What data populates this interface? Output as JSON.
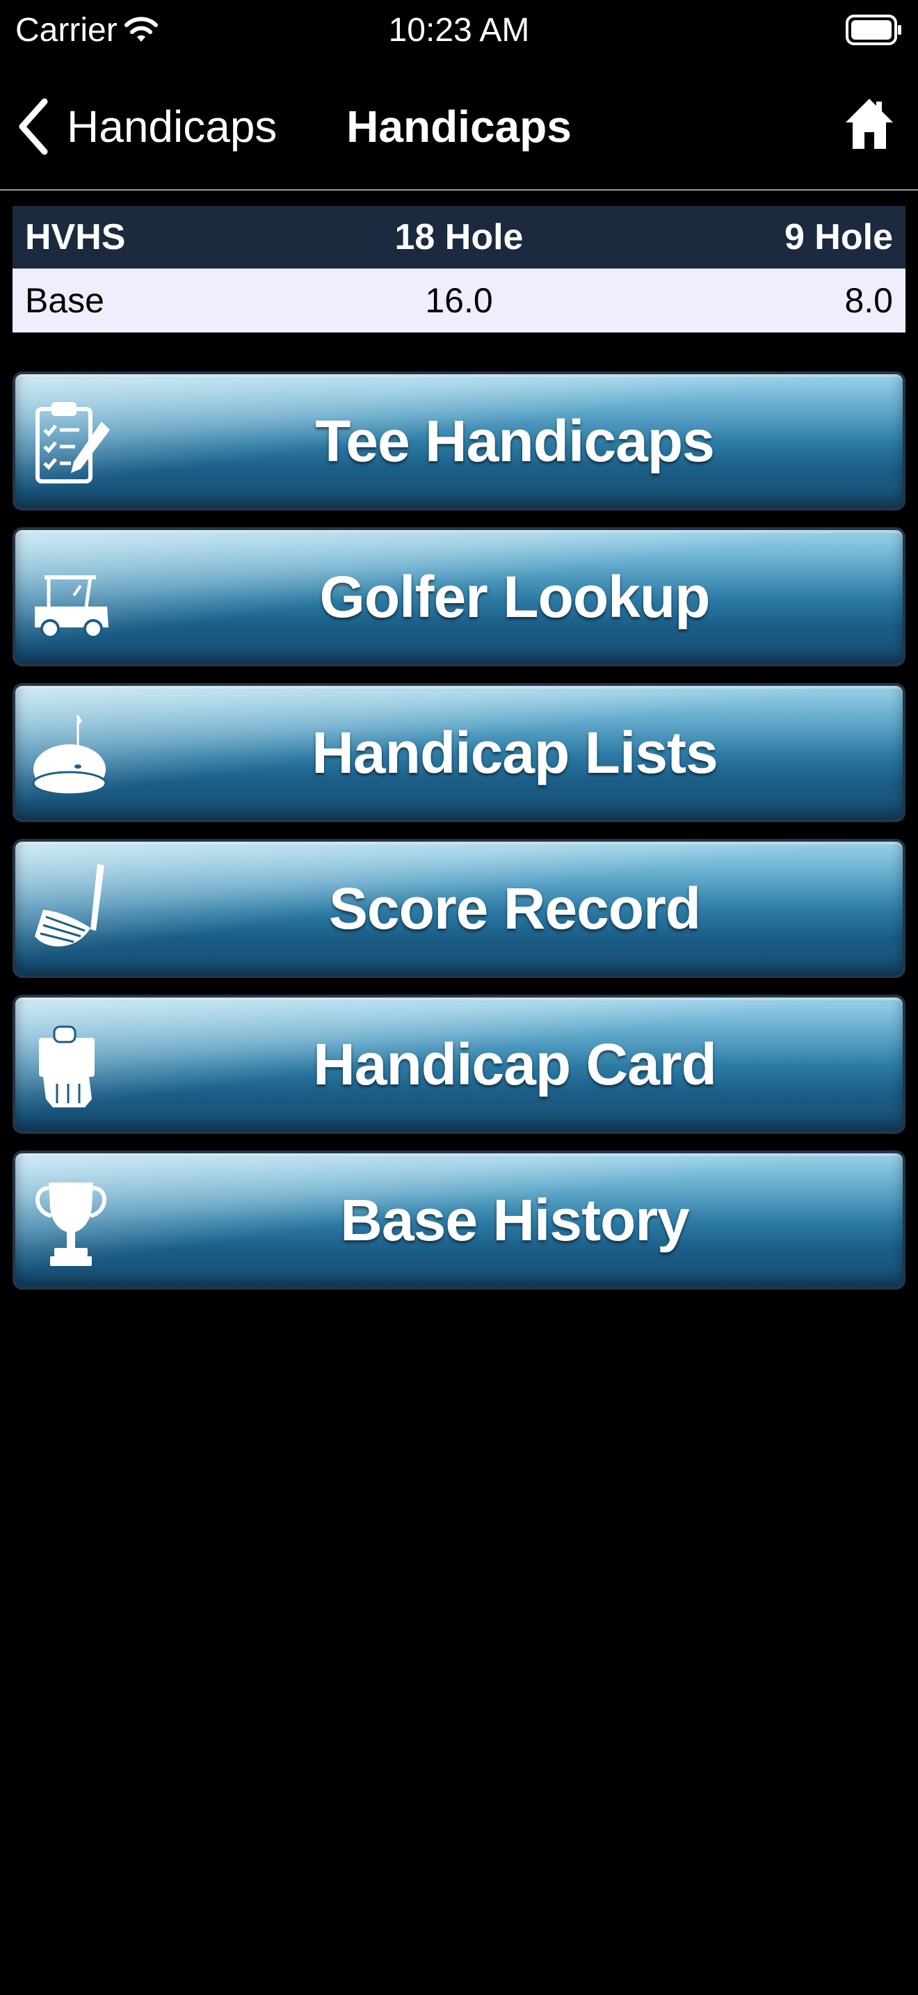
{
  "status_bar": {
    "carrier": "Carrier",
    "time": "10:23 AM"
  },
  "nav": {
    "back_label": "Handicaps",
    "title": "Handicaps",
    "icons": {
      "back": "chevron-left-icon",
      "home": "home-icon"
    }
  },
  "table": {
    "headers": [
      "HVHS",
      "18 Hole",
      "9 Hole"
    ],
    "rows": [
      [
        "Base",
        "16.0",
        "8.0"
      ]
    ]
  },
  "menu": {
    "items": [
      {
        "label": "Tee Handicaps",
        "icon": "clipboard-checklist-icon"
      },
      {
        "label": "Golfer Lookup",
        "icon": "golf-cart-icon"
      },
      {
        "label": "Handicap Lists",
        "icon": "putting-green-flag-icon"
      },
      {
        "label": "Score Record",
        "icon": "golf-club-icon"
      },
      {
        "label": "Handicap Card",
        "icon": "hand-holding-card-icon"
      },
      {
        "label": "Base History",
        "icon": "trophy-icon"
      }
    ]
  },
  "colors": {
    "background": "#000000",
    "table_header": "#1c2a3f",
    "table_row": "#eeeefd",
    "button_top": "#9ad3ea",
    "button_bottom": "#174d72",
    "button_border": "#24344b"
  }
}
